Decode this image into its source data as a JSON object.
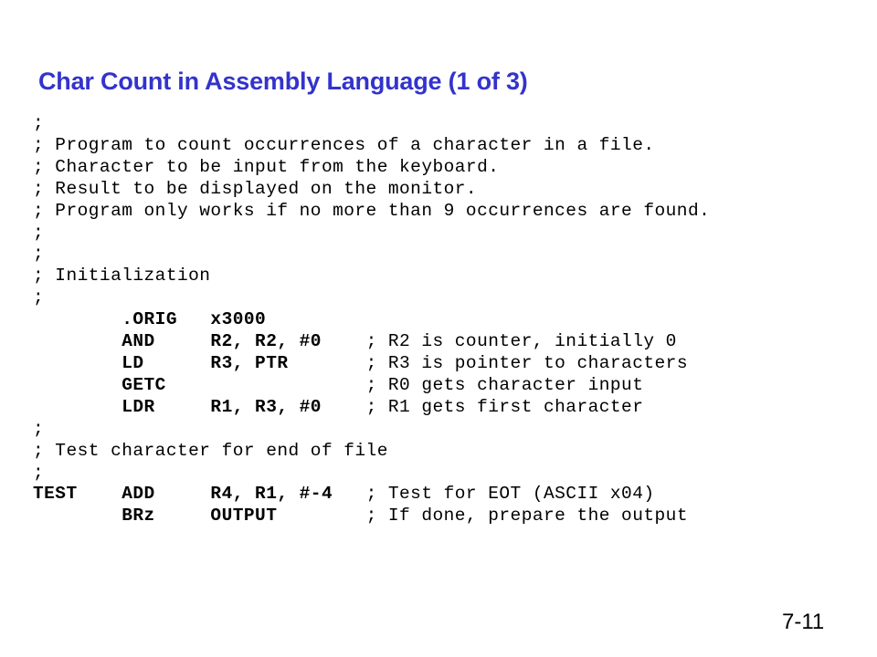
{
  "slide": {
    "title": "Char Count in Assembly Language (1 of 3)",
    "title_color": "#3333CC",
    "background_color": "#FFFFFF",
    "text_color": "#000000",
    "page_number": "7-11"
  },
  "code": {
    "lines": [
      {
        "bold": false,
        "text": ";"
      },
      {
        "bold": false,
        "text": "; Program to count occurrences of a character in a file."
      },
      {
        "bold": false,
        "text": "; Character to be input from the keyboard."
      },
      {
        "bold": false,
        "text": "; Result to be displayed on the monitor."
      },
      {
        "bold": false,
        "text": "; Program only works if no more than 9 occurrences are found."
      },
      {
        "bold": false,
        "text": ";"
      },
      {
        "bold": false,
        "text": ";"
      },
      {
        "bold": false,
        "text": "; Initialization"
      },
      {
        "bold": false,
        "text": ";"
      },
      {
        "bold": true,
        "code": "        .ORIG   x3000",
        "comment": ""
      },
      {
        "bold": true,
        "code": "        AND     R2, R2, #0    ",
        "comment": "; R2 is counter, initially 0"
      },
      {
        "bold": true,
        "code": "        LD      R3, PTR       ",
        "comment": "; R3 is pointer to characters"
      },
      {
        "bold": true,
        "code": "        GETC                  ",
        "comment": "; R0 gets character input"
      },
      {
        "bold": true,
        "code": "        LDR     R1, R3, #0    ",
        "comment": "; R1 gets first character"
      },
      {
        "bold": false,
        "text": ";"
      },
      {
        "bold": false,
        "text": "; Test character for end of file"
      },
      {
        "bold": false,
        "text": ";"
      },
      {
        "bold": true,
        "code": "TEST    ADD     R4, R1, #-4   ",
        "comment": "; Test for EOT (ASCII x04)"
      },
      {
        "bold": true,
        "code": "        BRz     OUTPUT        ",
        "comment": "; If done, prepare the output"
      }
    ]
  }
}
